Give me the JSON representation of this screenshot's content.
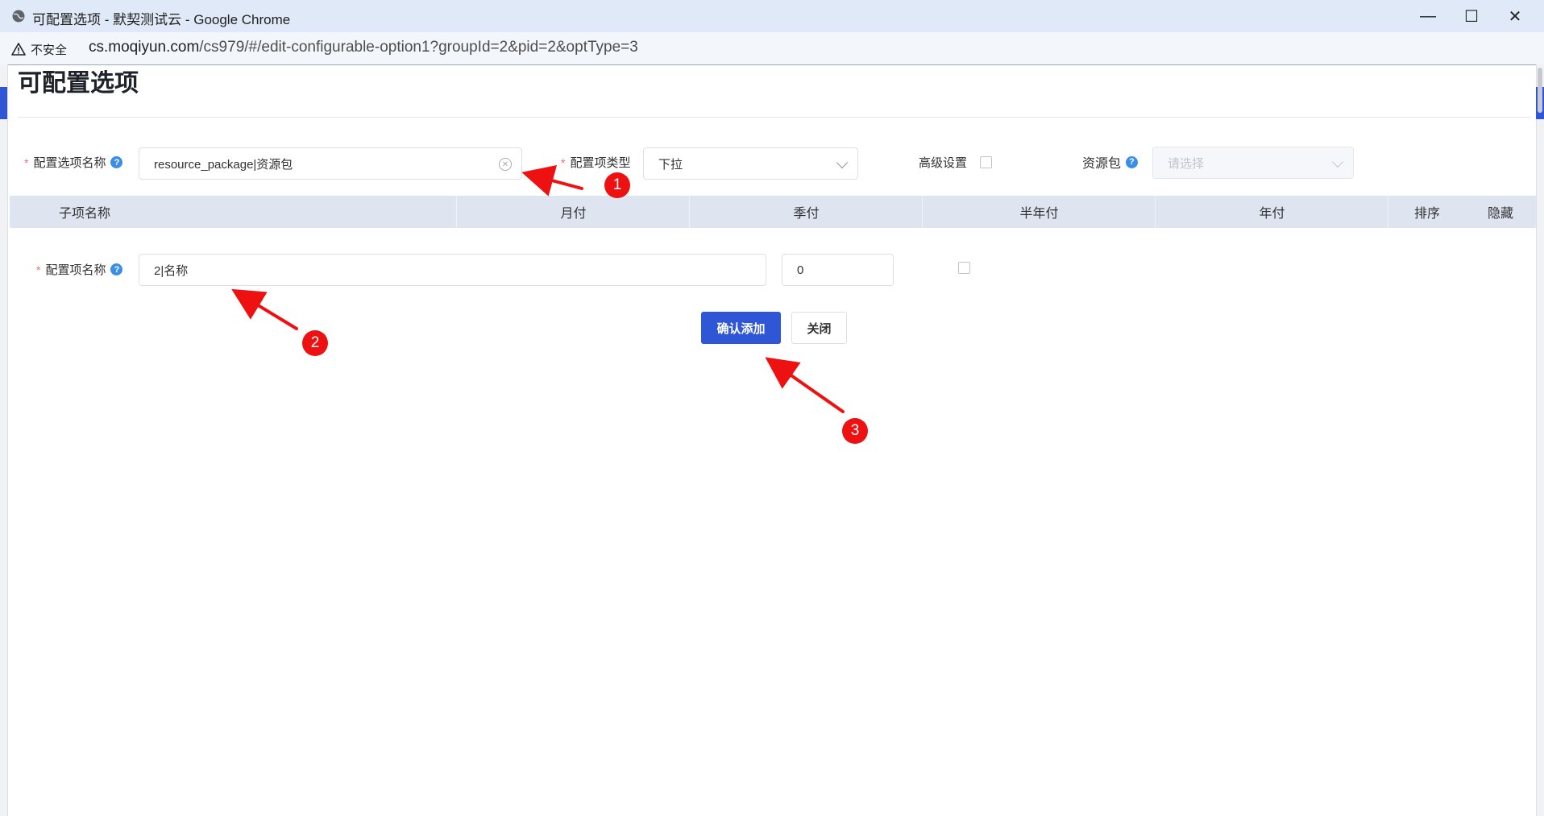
{
  "browser": {
    "window_title": "可配置选项 - 默契测试云 - Google Chrome",
    "insecure_label": "不安全",
    "url_host": "cs.moqiyun.com",
    "url_path": "/cs979/#/edit-configurable-option1?groupId=2&pid=2&optType=3",
    "minimize": "—",
    "maximize": "☐",
    "close": "✕"
  },
  "page": {
    "title": "可配置选项"
  },
  "form": {
    "required_mark": "*",
    "option_name_label": "配置选项名称",
    "option_name_value": "resource_package|资源包",
    "option_type_label": "配置项类型",
    "option_type_value": "下拉",
    "advanced_label": "高级设置",
    "resource_package_label": "资源包",
    "resource_package_placeholder": "请选择",
    "help_glyph": "?"
  },
  "table": {
    "headers": [
      "子项名称",
      "月付",
      "季付",
      "半年付",
      "年付",
      "排序",
      "隐藏"
    ]
  },
  "row": {
    "item_name_label": "配置项名称",
    "item_name_value": "2|名称",
    "monthly_value": "0"
  },
  "buttons": {
    "confirm_add": "确认添加",
    "close": "关闭"
  },
  "annotations": {
    "markers": [
      "1",
      "2",
      "3"
    ],
    "color": "#ee1111"
  },
  "colors": {
    "primary": "#2f56d6",
    "required": "#f56c6c",
    "help": "#3a8ee6",
    "table_header": "#dfe5f0"
  }
}
